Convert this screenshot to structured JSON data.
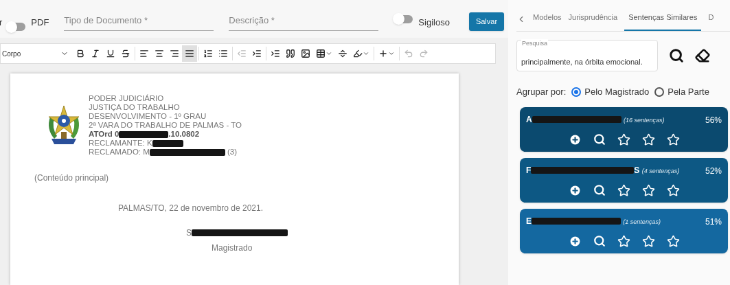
{
  "top_bar": {
    "cut_label": "r",
    "pdf_toggle": {
      "label": "PDF",
      "on": false
    },
    "fields": [
      {
        "placeholder": "Tipo de Documento *"
      },
      {
        "placeholder": "Descrição *"
      }
    ],
    "secret_toggle": {
      "label": "Sigiloso",
      "on": false
    },
    "save_button": "Salvar"
  },
  "toolbar": {
    "style_select": "Corpo",
    "tools": [
      {
        "kind": "bold",
        "selected": false,
        "disabled": false
      },
      {
        "kind": "italic",
        "selected": false,
        "disabled": false
      },
      {
        "kind": "underline",
        "selected": false,
        "disabled": false
      },
      {
        "kind": "strike",
        "selected": false,
        "disabled": false
      },
      {
        "kind": "align-left",
        "selected": false,
        "disabled": false
      },
      {
        "kind": "align-center",
        "selected": false,
        "disabled": false
      },
      {
        "kind": "align-right",
        "selected": false,
        "disabled": false
      },
      {
        "kind": "justify",
        "selected": true,
        "disabled": false
      },
      {
        "kind": "ordered-list",
        "selected": false,
        "disabled": false
      },
      {
        "kind": "bullet-list",
        "selected": false,
        "disabled": false
      },
      {
        "kind": "outdent",
        "selected": false,
        "disabled": true
      },
      {
        "kind": "indent",
        "selected": false,
        "disabled": false
      },
      {
        "kind": "indent-block",
        "selected": false,
        "disabled": false
      },
      {
        "kind": "quote",
        "selected": false,
        "disabled": false
      },
      {
        "kind": "image",
        "selected": false,
        "disabled": false
      },
      {
        "kind": "table",
        "selected": false,
        "disabled": false
      },
      {
        "kind": "page-break",
        "selected": false,
        "disabled": false
      },
      {
        "kind": "highlight",
        "selected": false,
        "disabled": false
      },
      {
        "kind": "insert",
        "selected": false,
        "disabled": false
      },
      {
        "kind": "undo",
        "selected": false,
        "disabled": true
      },
      {
        "kind": "redo",
        "selected": false,
        "disabled": true
      }
    ]
  },
  "document": {
    "header_lines": [
      {
        "kind": "plain",
        "text": "PODER JUDICIÁRIO"
      },
      {
        "kind": "plain",
        "text": "JUSTIÇA DO TRABALHO"
      },
      {
        "kind": "plain",
        "text": "DESENVOLVIMENTO - 1º GRAU"
      },
      {
        "kind": "plain",
        "text": "2ª VARA DO TRABALHO DE PALMAS - TO"
      },
      {
        "kind": "redacted",
        "bold": true,
        "prefix": "ATOrd 0",
        "suffix": ".10.0802"
      },
      {
        "kind": "redacted",
        "bold": false,
        "prefix": "RECLAMANTE: K"
      },
      {
        "kind": "redacted",
        "bold": false,
        "prefix": "RECLAMADO: M",
        "suffix": " (3)"
      }
    ],
    "content": "(Conteúdo principal)",
    "date": "PALMAS/TO, 22 de novembro de 2021.",
    "signature_prefix": "S",
    "signer_role": "Magistrado"
  },
  "side_panel": {
    "tabs": [
      {
        "label": "Modelos",
        "selected": false
      },
      {
        "label": "Jurisprudência",
        "selected": false
      },
      {
        "label": "Sentenças Similares",
        "selected": true
      },
      {
        "label": "D",
        "selected": false
      }
    ],
    "search": {
      "label": "Pesquisa",
      "value": "principalmente, na órbita emocional."
    },
    "group_by": {
      "label": "Agrupar por:",
      "options": [
        {
          "label": "Pelo Magistrado",
          "selected": true
        },
        {
          "label": "Pela Parte",
          "selected": false
        }
      ]
    },
    "results": [
      {
        "prefix": "A",
        "count": "(16 sentenças)",
        "percent": "56%",
        "color": "#0b4a6f",
        "stars": 0
      },
      {
        "prefix": "F",
        "suffix": "S",
        "count": "(4 sentenças)",
        "percent": "52%",
        "color": "#0d5884",
        "stars": 0
      },
      {
        "prefix": "E",
        "count": "(1 sentenças)",
        "percent": "51%",
        "color": "#1468a0",
        "stars": 0
      }
    ]
  }
}
